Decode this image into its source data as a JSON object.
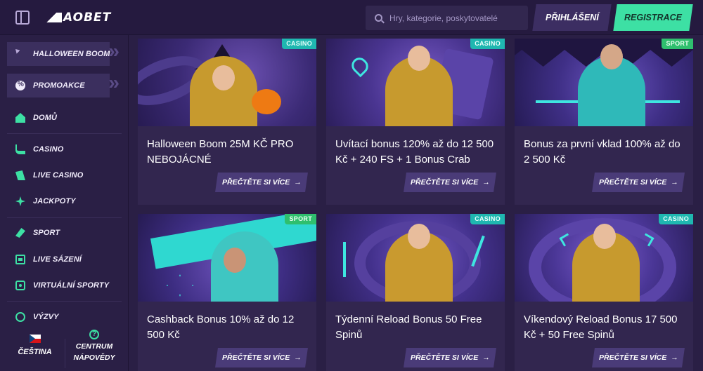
{
  "header": {
    "logo_text": "AOBET",
    "search_placeholder": "Hry, kategorie, poskytovatelé",
    "login_label": "PŘIHLÁŠENÍ",
    "register_label": "REGISTRACE"
  },
  "sidebar": {
    "items": [
      {
        "label": "HALLOWEEN BOOM",
        "icon": "halloween-icon"
      },
      {
        "label": "PROMOAKCE",
        "icon": "promo-icon"
      },
      {
        "label": "DOMŮ",
        "icon": "home-icon"
      },
      {
        "label": "CASINO",
        "icon": "casino-icon"
      },
      {
        "label": "LIVE CASINO",
        "icon": "live-casino-icon"
      },
      {
        "label": "JACKPOTY",
        "icon": "jackpot-icon"
      },
      {
        "label": "SPORT",
        "icon": "sport-icon"
      },
      {
        "label": "LIVE SÁZENÍ",
        "icon": "live-betting-icon"
      },
      {
        "label": "VIRTUÁLNÍ SPORTY",
        "icon": "virtual-sports-icon"
      },
      {
        "label": "VÝZVY",
        "icon": "challenges-icon"
      }
    ],
    "language_label": "ČEŠTINA",
    "help_label": "CENTRUM NÁPOVĚDY"
  },
  "cards": [
    {
      "tag": "CASINO",
      "title": "Halloween Boom 25M KČ PRO NEBOJÁCNÉ",
      "button": "PŘEČTĚTE SI VÍCE"
    },
    {
      "tag": "CASINO",
      "title": "Uvítací bonus 120% až do 12 500 Kč + 240 FS + 1 Bonus Crab",
      "button": "PŘEČTĚTE SI VÍCE"
    },
    {
      "tag": "SPORT",
      "title": "Bonus za první vklad 100% až do 2 500 Kč",
      "button": "PŘEČTĚTE SI VÍCE"
    },
    {
      "tag": "SPORT",
      "title": "Cashback Bonus 10% až do 12 500 Kč",
      "button": "PŘEČTĚTE SI VÍCE"
    },
    {
      "tag": "CASINO",
      "title": "Týdenní Reload Bonus 50 Free Spinů",
      "button": "PŘEČTĚTE SI VÍCE"
    },
    {
      "tag": "CASINO",
      "title": "Víkendový Reload Bonus 17 500 Kč + 50 Free Spinů",
      "button": "PŘEČTĚTE SI VÍCE"
    }
  ],
  "colors": {
    "accent": "#3de0a4",
    "background": "#2a1f45",
    "card": "#32264f",
    "casino_tag": "#1fb7b0",
    "sport_tag": "#2fbf6e"
  }
}
